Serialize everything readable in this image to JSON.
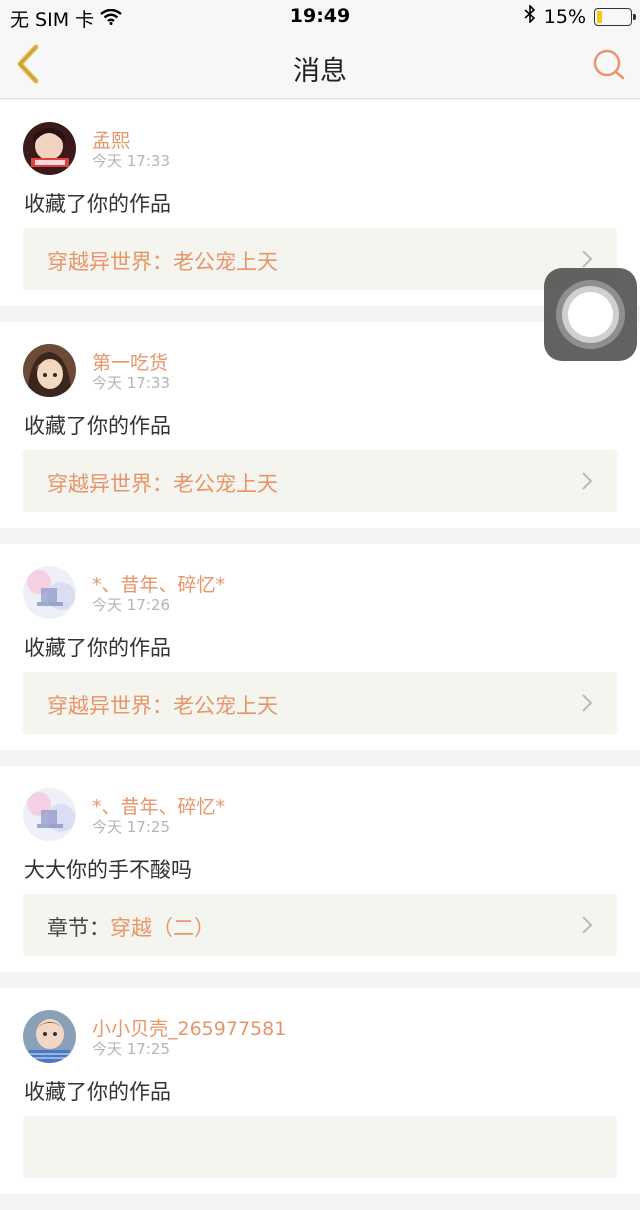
{
  "status_bar": {
    "carrier": "无 SIM 卡",
    "time": "19:49",
    "battery_percent": "15%",
    "battery_level": 0.15
  },
  "nav": {
    "title": "消息"
  },
  "messages": [
    {
      "username": "孟熙",
      "time": "今天 17:33",
      "text": "收藏了你的作品",
      "link_prefix": "",
      "link_title": "穿越异世界：老公宠上天"
    },
    {
      "username": "第一吃货",
      "time": "今天 17:33",
      "text": "收藏了你的作品",
      "link_prefix": "",
      "link_title": "穿越异世界：老公宠上天"
    },
    {
      "username": "*、昔年、碎忆*",
      "time": "今天 17:26",
      "text": "收藏了你的作品",
      "link_prefix": "",
      "link_title": "穿越异世界：老公宠上天"
    },
    {
      "username": "*、昔年、碎忆*",
      "time": "今天 17:25",
      "text": "大大你的手不酸吗",
      "link_prefix": "章节：",
      "link_title": "穿越（二）"
    },
    {
      "username": "小小贝壳_265977581",
      "time": "今天 17:25",
      "text": "收藏了你的作品",
      "link_prefix": "",
      "link_title": ""
    }
  ],
  "colors": {
    "accent": "#e8956a",
    "nav_back": "#e2b84a"
  }
}
